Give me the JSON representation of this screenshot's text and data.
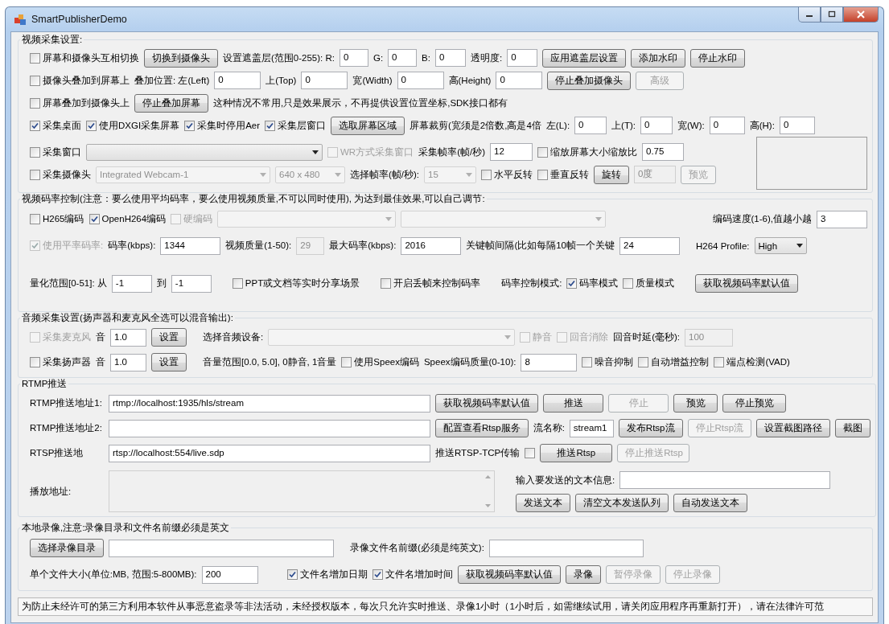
{
  "window": {
    "title": "SmartPublisherDemo"
  },
  "groups": [
    {
      "title": "视频采集设置:",
      "rows": [
        {
          "items": [
            {
              "kind": "checkbox",
              "label": "屏幕和摄像头互相切换",
              "checked": false,
              "disabled": false
            },
            {
              "kind": "button",
              "label": "切换到摄像头",
              "disabled": false
            },
            {
              "kind": "label",
              "text": "设置遮盖层(范围0-255): R:"
            },
            {
              "kind": "input",
              "value": "0",
              "disabled": false
            },
            {
              "kind": "label",
              "text": "G:"
            },
            {
              "kind": "input",
              "value": "0",
              "disabled": false
            },
            {
              "kind": "label",
              "text": "B:"
            },
            {
              "kind": "input",
              "value": "0",
              "disabled": false
            },
            {
              "kind": "label",
              "text": "透明度:"
            },
            {
              "kind": "input",
              "value": "0",
              "disabled": false
            },
            {
              "kind": "button",
              "label": "应用遮盖层设置",
              "disabled": false
            },
            {
              "kind": "button",
              "label": "添加水印",
              "disabled": false
            },
            {
              "kind": "button",
              "label": "停止水印",
              "disabled": false
            }
          ]
        },
        {
          "items": [
            {
              "kind": "checkbox",
              "label": "摄像头叠加到屏幕上",
              "checked": false,
              "disabled": false
            },
            {
              "kind": "label",
              "text": "叠加位置: 左(Left)"
            },
            {
              "kind": "input",
              "value": "0",
              "disabled": false
            },
            {
              "kind": "label",
              "text": "上(Top)"
            },
            {
              "kind": "input",
              "value": "0",
              "disabled": false
            },
            {
              "kind": "label",
              "text": "宽(Width)"
            },
            {
              "kind": "input",
              "value": "0",
              "disabled": false
            },
            {
              "kind": "label",
              "text": "高(Height)"
            },
            {
              "kind": "input",
              "value": "0",
              "disabled": false
            },
            {
              "kind": "button",
              "label": "停止叠加摄像头",
              "disabled": false
            },
            {
              "kind": "button",
              "label": "高级",
              "disabled": true
            }
          ]
        },
        {
          "items": [
            {
              "kind": "checkbox",
              "label": "屏幕叠加到摄像头上",
              "checked": false,
              "disabled": false
            },
            {
              "kind": "button",
              "label": "停止叠加屏幕",
              "disabled": false
            },
            {
              "kind": "label",
              "text": "这种情况不常用,只是效果展示，不再提供设置位置坐标,SDK接口都有"
            }
          ]
        },
        {
          "items": [
            {
              "kind": "checkbox",
              "label": "采集桌面",
              "checked": true,
              "disabled": false
            },
            {
              "kind": "checkbox",
              "label": "使用DXGI采集屏幕",
              "checked": true,
              "disabled": false
            },
            {
              "kind": "checkbox",
              "label": "采集时停用Aer",
              "checked": true,
              "disabled": false
            },
            {
              "kind": "checkbox",
              "label": "采集层窗口",
              "checked": true,
              "disabled": false
            },
            {
              "kind": "button",
              "label": "选取屏幕区域",
              "disabled": false
            },
            {
              "kind": "label",
              "text": "屏幕裁剪(宽须是2倍数,高是4倍"
            },
            {
              "kind": "label",
              "text": "左(L):"
            },
            {
              "kind": "input",
              "value": "0",
              "disabled": false
            },
            {
              "kind": "label",
              "text": "上(T):"
            },
            {
              "kind": "input",
              "value": "0",
              "disabled": false
            },
            {
              "kind": "label",
              "text": "宽(W):"
            },
            {
              "kind": "input",
              "value": "0",
              "disabled": false
            },
            {
              "kind": "label",
              "text": "高(H):"
            },
            {
              "kind": "input",
              "value": "0",
              "disabled": false
            }
          ]
        },
        {
          "items": [
            {
              "kind": "stack",
              "rows": [
                {
                  "items": [
                    {
                      "kind": "checkbox",
                      "label": "采集窗口",
                      "checked": false,
                      "disabled": false
                    },
                    {
                      "kind": "select",
                      "disabled": false
                    },
                    {
                      "kind": "checkbox",
                      "label": "WR方式采集窗口",
                      "checked": false,
                      "disabled": true
                    },
                    {
                      "kind": "label",
                      "text": "采集帧率(帧/秒)"
                    },
                    {
                      "kind": "input",
                      "value": "12",
                      "disabled": false
                    },
                    {
                      "kind": "checkbox",
                      "label": "缩放屏幕大小缩放比",
                      "checked": false,
                      "disabled": false
                    },
                    {
                      "kind": "input",
                      "value": "0.75",
                      "disabled": false
                    }
                  ]
                },
                {
                  "items": [
                    {
                      "kind": "checkbox",
                      "label": "采集摄像头",
                      "checked": false,
                      "disabled": false
                    },
                    {
                      "kind": "select",
                      "value": "Integrated Webcam-1",
                      "disabled": true
                    },
                    {
                      "kind": "select",
                      "value": "640 x 480",
                      "disabled": true
                    },
                    {
                      "kind": "label",
                      "text": "选择帧率(帧/秒):"
                    },
                    {
                      "kind": "select",
                      "value": "15",
                      "disabled": true
                    },
                    {
                      "kind": "checkbox",
                      "label": "水平反转",
                      "checked": false,
                      "disabled": false
                    },
                    {
                      "kind": "checkbox",
                      "label": "垂直反转",
                      "checked": false,
                      "disabled": false
                    },
                    {
                      "kind": "button",
                      "label": "旋转",
                      "disabled": false
                    },
                    {
                      "kind": "readout",
                      "value": "0度"
                    },
                    {
                      "kind": "button",
                      "label": "预览",
                      "disabled": true
                    }
                  ]
                }
              ]
            },
            {
              "kind": "preview"
            }
          ]
        }
      ]
    },
    {
      "title": "视频码率控制(注意：要么使用平均码率，要么使用视频质量,不可以同时使用), 为达到最佳效果,可以自己调节:",
      "rows": [
        {
          "items": [
            {
              "kind": "checkbox",
              "label": "H265编码",
              "checked": false,
              "disabled": false
            },
            {
              "kind": "checkbox",
              "label": "OpenH264编码",
              "checked": true,
              "disabled": false
            },
            {
              "kind": "checkbox",
              "label": "硬编码",
              "checked": false,
              "disabled": true
            },
            {
              "kind": "select",
              "disabled": true
            },
            {
              "kind": "select",
              "disabled": true
            },
            {
              "kind": "label",
              "text": "编码速度(1-6),值越小越"
            },
            {
              "kind": "input",
              "value": "3",
              "disabled": false
            }
          ]
        },
        {
          "items": [
            {
              "kind": "checkbox",
              "label": "使用平率码率:",
              "checked": true,
              "disabled": true
            },
            {
              "kind": "label",
              "text": "码率(kbps):"
            },
            {
              "kind": "input",
              "value": "1344",
              "disabled": false
            },
            {
              "kind": "label",
              "text": "视频质量(1-50):"
            },
            {
              "kind": "input",
              "value": "29",
              "disabled": true
            },
            {
              "kind": "label",
              "text": "最大码率(kbps):"
            },
            {
              "kind": "input",
              "value": "2016",
              "disabled": false
            },
            {
              "kind": "label",
              "text": "关键帧间隔(比如每隔10帧一个关键"
            },
            {
              "kind": "input",
              "value": "24",
              "disabled": false
            },
            {
              "kind": "label",
              "text": "H264 Profile:"
            },
            {
              "kind": "select",
              "value": "High",
              "disabled": false
            }
          ]
        },
        {
          "items": [
            {
              "kind": "label",
              "text": "量化范围[0-51]: 从"
            },
            {
              "kind": "input",
              "value": "-1",
              "disabled": false
            },
            {
              "kind": "label",
              "text": "到"
            },
            {
              "kind": "input",
              "value": "-1",
              "disabled": false
            },
            {
              "kind": "checkbox",
              "label": "PPT或文档等实时分享场景",
              "checked": false,
              "disabled": false
            },
            {
              "kind": "checkbox",
              "label": "开启丢帧来控制码率",
              "checked": false,
              "disabled": false
            },
            {
              "kind": "label",
              "text": "码率控制模式:"
            },
            {
              "kind": "checkbox",
              "label": "码率模式",
              "checked": true,
              "disabled": false
            },
            {
              "kind": "checkbox",
              "label": "质量模式",
              "checked": false,
              "disabled": false
            },
            {
              "kind": "button",
              "label": "获取视频码率默认值",
              "disabled": false
            }
          ]
        }
      ]
    },
    {
      "title": "音频采集设置(扬声器和麦克风全选可以混音输出):",
      "rows": [
        {
          "items": [
            {
              "kind": "checkbox",
              "label": "采集麦克风",
              "checked": false,
              "disabled": true
            },
            {
              "kind": "label",
              "text": "音"
            },
            {
              "kind": "input",
              "value": "1.0",
              "disabled": false
            },
            {
              "kind": "button",
              "label": "设置",
              "disabled": false
            },
            {
              "kind": "label",
              "text": "选择音频设备:"
            },
            {
              "kind": "select",
              "disabled": true
            },
            {
              "kind": "checkbox",
              "label": "静音",
              "checked": false,
              "disabled": true
            },
            {
              "kind": "checkbox",
              "label": "回音消除",
              "checked": false,
              "disabled": true
            },
            {
              "kind": "label",
              "text": "回音时延(毫秒):"
            },
            {
              "kind": "input",
              "value": "100",
              "disabled": true
            }
          ]
        },
        {
          "items": [
            {
              "kind": "checkbox",
              "label": "采集扬声器",
              "checked": false,
              "disabled": false
            },
            {
              "kind": "label",
              "text": "音"
            },
            {
              "kind": "input",
              "value": "1.0",
              "disabled": false
            },
            {
              "kind": "button",
              "label": "设置",
              "disabled": false
            },
            {
              "kind": "label",
              "text": "音量范围[0.0, 5.0], 0静音, 1音量"
            },
            {
              "kind": "checkbox",
              "label": "使用Speex编码",
              "checked": false,
              "disabled": false
            },
            {
              "kind": "label",
              "text": "Speex编码质量(0-10):"
            },
            {
              "kind": "input",
              "value": "8",
              "disabled": false
            },
            {
              "kind": "checkbox",
              "label": "噪音抑制",
              "checked": false,
              "disabled": false
            },
            {
              "kind": "checkbox",
              "label": "自动增益控制",
              "checked": false,
              "disabled": false
            },
            {
              "kind": "checkbox",
              "label": "端点检测(VAD)",
              "checked": false,
              "disabled": false
            }
          ]
        }
      ]
    },
    {
      "title": "RTMP推送",
      "rows": [
        {
          "items": [
            {
              "kind": "label",
              "text": "RTMP推送地址1:"
            },
            {
              "kind": "input",
              "value": "rtmp://localhost:1935/hls/stream",
              "disabled": false
            },
            {
              "kind": "button",
              "label": "获取视频码率默认值",
              "disabled": false
            },
            {
              "kind": "button",
              "label": "推送",
              "disabled": false
            },
            {
              "kind": "button",
              "label": "停止",
              "disabled": true
            },
            {
              "kind": "button",
              "label": "预览",
              "disabled": false
            },
            {
              "kind": "button",
              "label": "停止预览",
              "disabled": false
            }
          ]
        },
        {
          "items": [
            {
              "kind": "label",
              "text": "RTMP推送地址2:"
            },
            {
              "kind": "input",
              "disabled": false
            },
            {
              "kind": "button",
              "label": "配置查看Rtsp服务",
              "disabled": false
            },
            {
              "kind": "label",
              "text": "流名称:"
            },
            {
              "kind": "input",
              "value": "stream1",
              "disabled": false
            },
            {
              "kind": "button",
              "label": "发布Rtsp流",
              "disabled": false
            },
            {
              "kind": "button",
              "label": "停止Rtsp流",
              "disabled": true
            },
            {
              "kind": "button",
              "label": "设置截图路径",
              "disabled": false
            },
            {
              "kind": "button",
              "label": "截图",
              "disabled": false
            }
          ]
        },
        {
          "items": [
            {
              "kind": "label",
              "text": "RTSP推送地"
            },
            {
              "kind": "input",
              "value": "rtsp://localhost:554/live.sdp",
              "disabled": false
            },
            {
              "kind": "label",
              "text": "推送RTSP-TCP传输"
            },
            {
              "kind": "checkbox",
              "checked": false,
              "disabled": false
            },
            {
              "kind": "button",
              "label": "推送Rtsp",
              "disabled": false
            },
            {
              "kind": "button",
              "label": "停止推送Rtsp",
              "disabled": true
            }
          ]
        },
        {
          "items": [
            {
              "kind": "label",
              "text": "播放地址:"
            },
            {
              "kind": "textarea",
              "disabled": true
            },
            {
              "kind": "stack",
              "rows": [
                {
                  "items": [
                    {
                      "kind": "label",
                      "text": "输入要发送的文本信息:"
                    },
                    {
                      "kind": "input",
                      "disabled": false
                    }
                  ]
                },
                {
                  "items": [
                    {
                      "kind": "button",
                      "label": "发送文本",
                      "disabled": false
                    },
                    {
                      "kind": "button",
                      "label": "清空文本发送队列",
                      "disabled": false
                    },
                    {
                      "kind": "button",
                      "label": "自动发送文本",
                      "disabled": false
                    }
                  ]
                }
              ]
            }
          ]
        }
      ]
    },
    {
      "title": "本地录像,注意:录像目录和文件名前缀必须是英文",
      "rows": [
        {
          "items": [
            {
              "kind": "button",
              "label": "选择录像目录",
              "disabled": false
            },
            {
              "kind": "input",
              "disabled": false
            },
            {
              "kind": "label",
              "text": "录像文件名前缀(必须是纯英文):"
            },
            {
              "kind": "input",
              "disabled": false
            }
          ]
        },
        {
          "items": [
            {
              "kind": "label",
              "text": "单个文件大小(单位:MB, 范围:5-800MB):"
            },
            {
              "kind": "input",
              "value": "200",
              "disabled": false
            },
            {
              "kind": "checkbox",
              "label": "文件名增加日期",
              "checked": true,
              "disabled": false
            },
            {
              "kind": "checkbox",
              "label": "文件名增加时间",
              "checked": true,
              "disabled": false
            },
            {
              "kind": "button",
              "label": "获取视频码率默认值",
              "disabled": false
            },
            {
              "kind": "button",
              "label": "录像",
              "disabled": false
            },
            {
              "kind": "button",
              "label": "暂停录像",
              "disabled": true
            },
            {
              "kind": "button",
              "label": "停止录像",
              "disabled": true
            }
          ]
        }
      ]
    }
  ],
  "status_bar": "为防止未经许可的第三方利用本软件从事恶意盗录等非法活动，未经授权版本，每次只允许实时推送、录像1小时（1小时后，如需继续试用，请关闭应用程序再重新打开），请在法律许可范"
}
